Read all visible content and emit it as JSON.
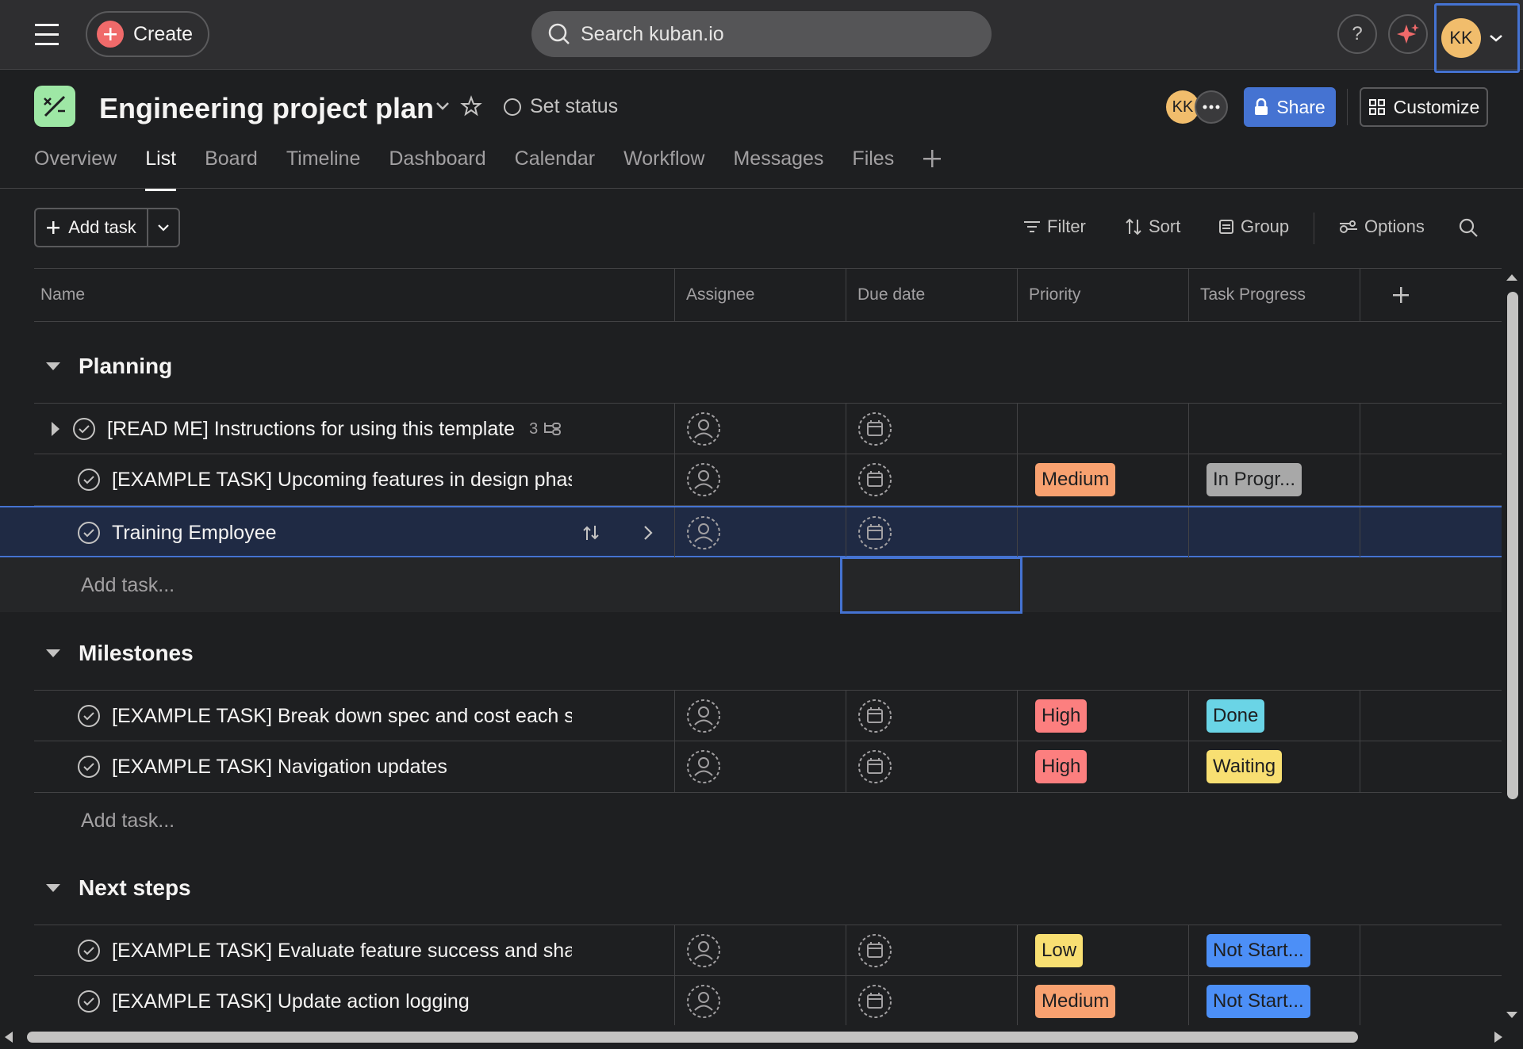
{
  "topbar": {
    "create_label": "Create",
    "search_placeholder": "Search kuban.io",
    "help_label": "?",
    "account_initials": "KK"
  },
  "project": {
    "title": "Engineering project plan",
    "set_status_label": "Set status",
    "member_initials": "KK",
    "share_label": "Share",
    "customize_label": "Customize"
  },
  "tabs": [
    "Overview",
    "List",
    "Board",
    "Timeline",
    "Dashboard",
    "Calendar",
    "Workflow",
    "Messages",
    "Files"
  ],
  "active_tab": "List",
  "toolbar": {
    "add_task_label": "Add task",
    "filter_label": "Filter",
    "sort_label": "Sort",
    "group_label": "Group",
    "options_label": "Options"
  },
  "columns": {
    "name": "Name",
    "assignee": "Assignee",
    "due_date": "Due date",
    "priority": "Priority",
    "progress": "Task Progress"
  },
  "sections": [
    {
      "title": "Planning",
      "tasks": [
        {
          "name": "[READ ME] Instructions for using this template",
          "subtask_count": "3",
          "priority": "",
          "progress": ""
        },
        {
          "name": "[EXAMPLE TASK] Upcoming features in design phas",
          "priority": "Medium",
          "progress": "In Progr..."
        },
        {
          "name": "Training Employee",
          "priority": "",
          "progress": ""
        }
      ],
      "add_task_label": "Add task..."
    },
    {
      "title": "Milestones",
      "tasks": [
        {
          "name": "[EXAMPLE TASK] Break down spec and cost each stó",
          "priority": "High",
          "progress": "Done"
        },
        {
          "name": "[EXAMPLE TASK] Navigation updates",
          "priority": "High",
          "progress": "Waiting"
        }
      ],
      "add_task_label": "Add task..."
    },
    {
      "title": "Next steps",
      "tasks": [
        {
          "name": "[EXAMPLE TASK] Evaluate feature success and share",
          "priority": "Low",
          "progress": "Not Start..."
        },
        {
          "name": "[EXAMPLE TASK] Update action logging",
          "priority": "Medium",
          "progress": "Not Start..."
        }
      ]
    }
  ],
  "colors": {
    "priority_medium": "#f8a170",
    "priority_high": "#fc7f7f",
    "priority_low": "#f8df72",
    "progress_in_progress": "#a8a8a8",
    "progress_done": "#6ad4e6",
    "progress_waiting": "#f8df72",
    "progress_not_started": "#4c8ff7",
    "accent": "#4573d2",
    "create_plus": "#f06a6a"
  },
  "icons": [
    "hamburger-icon",
    "plus-icon",
    "search-icon",
    "help-icon",
    "sparkle-icon",
    "chevron-down-icon",
    "star-icon",
    "status-circle-icon",
    "lock-icon",
    "customize-icon",
    "filter-icon",
    "sort-icon",
    "group-icon",
    "options-icon",
    "check-circle-icon",
    "assignee-icon",
    "calendar-icon",
    "subtask-icon",
    "caret-down-icon",
    "caret-right-icon"
  ]
}
